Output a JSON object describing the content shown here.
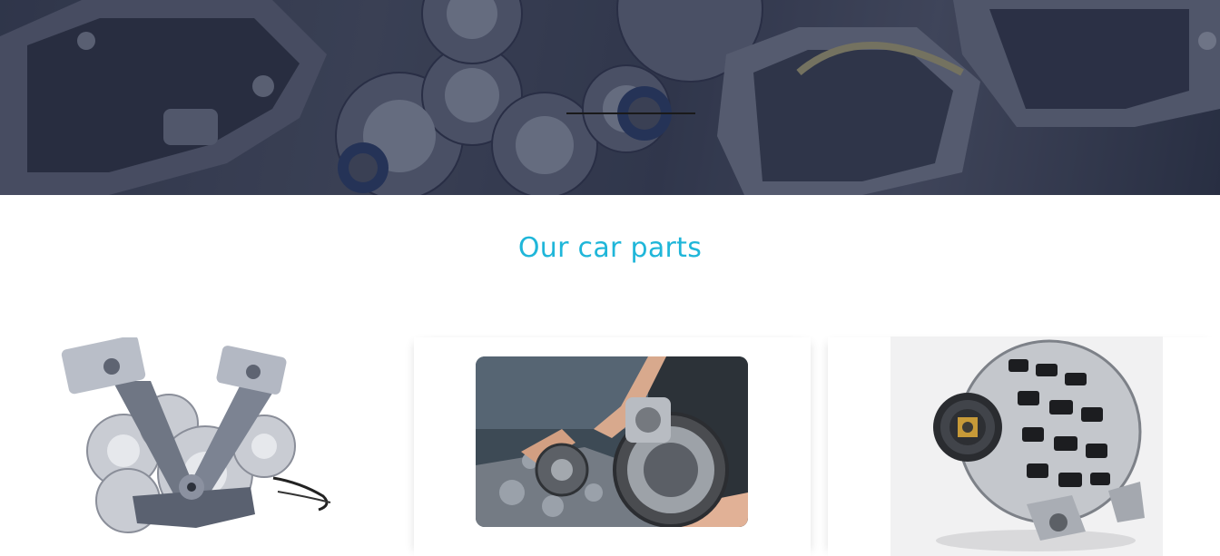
{
  "hero": {
    "image": "car-gearbox-parts-banner",
    "accent_color": "#3a3f52"
  },
  "section": {
    "title": "Our car parts",
    "title_color": "#1fb6d9"
  },
  "parts": [
    {
      "image": "engine-pistons-and-gears-photo"
    },
    {
      "image": "mechanic-repairing-gearbox-photo"
    },
    {
      "image": "car-alternator-photo"
    }
  ]
}
